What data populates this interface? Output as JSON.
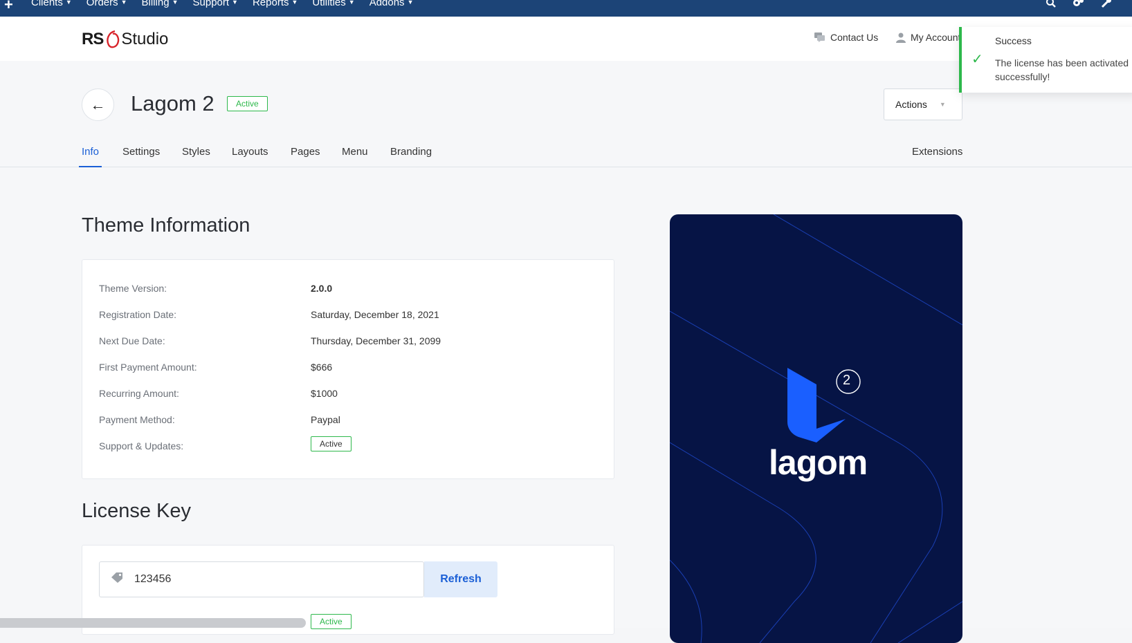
{
  "topbar": {
    "menu": [
      {
        "label": "Clients"
      },
      {
        "label": "Orders"
      },
      {
        "label": "Billing"
      },
      {
        "label": "Support"
      },
      {
        "label": "Reports"
      },
      {
        "label": "Utilities"
      },
      {
        "label": "Addons"
      }
    ],
    "icons": [
      "plus-icon",
      "search-icon",
      "gears-icon",
      "wrench-icon"
    ]
  },
  "header": {
    "logo": {
      "left": "RS",
      "right": "Studio"
    },
    "contact_label": "Contact Us",
    "account_label": "My Account"
  },
  "page": {
    "title": "Lagom 2",
    "status": "Active",
    "actions_label": "Actions"
  },
  "tabs": {
    "items": [
      {
        "label": "Info",
        "active": true
      },
      {
        "label": "Settings"
      },
      {
        "label": "Styles"
      },
      {
        "label": "Layouts"
      },
      {
        "label": "Pages"
      },
      {
        "label": "Menu"
      },
      {
        "label": "Branding"
      }
    ],
    "right_label": "Extensions"
  },
  "theme_info": {
    "title": "Theme Information",
    "rows": [
      {
        "label": "Theme Version:",
        "value": "2.0.0"
      },
      {
        "label": "Registration Date:",
        "value": "Saturday, December 18, 2021"
      },
      {
        "label": "Next Due Date:",
        "value": "Thursday, December 31, 2099"
      },
      {
        "label": "First Payment Amount:",
        "value": "$666"
      },
      {
        "label": "Recurring Amount:",
        "value": "$1000"
      },
      {
        "label": "Payment Method:",
        "value": "Paypal"
      },
      {
        "label": "Support & Updates:",
        "value": "Active"
      }
    ]
  },
  "license": {
    "title": "License Key",
    "key": "123456",
    "refresh_label": "Refresh",
    "status": "Active"
  },
  "promo": {
    "brand": "lagom",
    "version": "2",
    "colors": {
      "bg": "#061445",
      "accent": "#1a5fff"
    }
  },
  "toast": {
    "title": "Success",
    "message": "The license has been activated successfully!"
  },
  "colors": {
    "topbar": "#1c4477",
    "primary": "#1a5fd6",
    "success": "#2db84b"
  }
}
